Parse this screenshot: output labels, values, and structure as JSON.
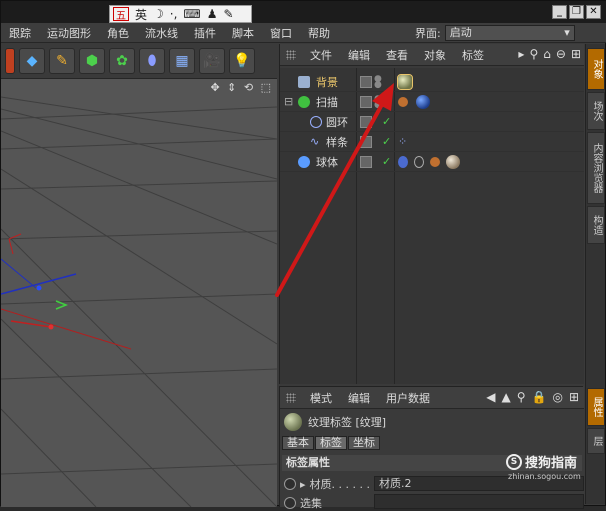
{
  "ime_bar": {
    "logo": "五",
    "lang": "英"
  },
  "menubar": {
    "items": [
      "跟踪",
      "运动图形",
      "角色",
      "流水线",
      "插件",
      "脚本",
      "窗口",
      "帮助"
    ],
    "layout_label": "界面:",
    "layout_value": "启动"
  },
  "object_manager": {
    "menu": [
      "文件",
      "编辑",
      "查看",
      "对象",
      "标签"
    ],
    "objects": [
      {
        "name": "背景",
        "selected": true
      },
      {
        "name": "扫描",
        "selected": false
      },
      {
        "name": "圆环",
        "selected": false
      },
      {
        "name": "样条",
        "selected": false
      },
      {
        "name": "球体",
        "selected": false
      }
    ]
  },
  "right_tabs": [
    "对象",
    "场次",
    "内容浏览器",
    "构造"
  ],
  "right_tabs_lower": [
    "属性",
    "层"
  ],
  "attribute_manager": {
    "menu": [
      "模式",
      "编辑",
      "用户数据"
    ],
    "title": "纹理标签 [纹理]",
    "tabs": [
      "基本",
      "标签",
      "坐标"
    ],
    "section": "标签属性",
    "props": [
      {
        "label": "材质. . . . . .",
        "value": "材质.2"
      },
      {
        "label": "选集",
        "value": ""
      }
    ]
  },
  "watermark": {
    "text": "搜狗指南",
    "sub": "zhinan.sogou.com"
  },
  "colors": {
    "accent": "#b36a00",
    "selected_text": "#e8c46a",
    "arrow": "#d01818",
    "check": "#4cd04c"
  }
}
